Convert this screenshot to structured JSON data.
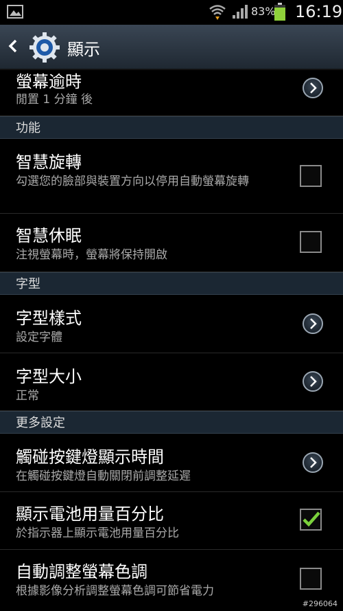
{
  "status_bar": {
    "battery_percent": "83%",
    "time": "16:19",
    "icons": [
      "gallery-icon",
      "wifi-icon",
      "signal-icon",
      "battery-icon"
    ]
  },
  "action_bar": {
    "title": "顯示",
    "icons": [
      "back-chevron-icon",
      "settings-gear-icon"
    ]
  },
  "items": {
    "screen_timeout": {
      "title": "螢幕逾時",
      "sub": "閒置 1 分鐘 後"
    },
    "header_function": "功能",
    "smart_rotation": {
      "title": "智慧旋轉",
      "sub": "勾選您的臉部與裝置方向以停用自動螢幕旋轉",
      "checked": false
    },
    "smart_stay": {
      "title": "智慧休眠",
      "sub": "注視螢幕時，螢幕將保持開啟",
      "checked": false
    },
    "header_font": "字型",
    "font_style": {
      "title": "字型樣式",
      "sub": "設定字體"
    },
    "font_size": {
      "title": "字型大小",
      "sub": "正常"
    },
    "header_more": "更多設定",
    "touch_key_light": {
      "title": "觸碰按鍵燈顯示時間",
      "sub": "在觸碰按鍵燈自動關閉前調整延遲"
    },
    "battery_percent": {
      "title": "顯示電池用量百分比",
      "sub": "於指示器上顯示電池用量百分比",
      "checked": true
    },
    "auto_adjust_tone": {
      "title": "自動調整螢幕色調",
      "sub": "根據影像分析調整螢幕色調可節省電力",
      "checked": false
    }
  },
  "colors": {
    "accent_check": "#7bd13c",
    "header_bg": "#1b2733",
    "battery": "#8fd13a"
  },
  "watermark": "#296064"
}
